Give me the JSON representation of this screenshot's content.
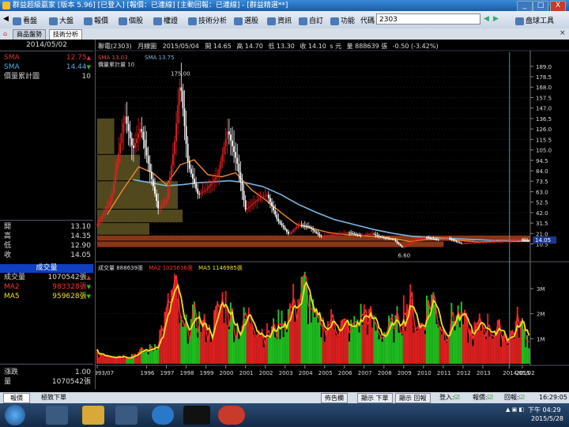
{
  "window": {
    "title": "群益超級贏家 [版本 5.96] [已登入] [報價：已連線] [主動回報：已連線] - [群益精選**]",
    "min": "_",
    "max": "□",
    "close": "X"
  },
  "menu": {
    "items": [
      "看盤",
      "大盤",
      "報價",
      "個股",
      "權證",
      "技術分析",
      "選股",
      "資訊",
      "自訂",
      "功能"
    ],
    "code_label": "代碼",
    "code_value": "2303",
    "right_item": "盘球工具"
  },
  "tabs": [
    "商品盤勢",
    "技術分析"
  ],
  "left_panel": {
    "date": "2014/05/02",
    "indicators": [
      {
        "label": "SMA",
        "value": "12.75",
        "arrow": "▲"
      },
      {
        "label": "SMA",
        "value": "14.44",
        "arrow": "▼"
      },
      {
        "label": "價量累計圖",
        "value": "10",
        "arrow": ""
      }
    ],
    "ohlc": [
      {
        "label": "開",
        "value": "13.10"
      },
      {
        "label": "高",
        "value": "14.35"
      },
      {
        "label": "低",
        "value": "12.90"
      },
      {
        "label": "收",
        "value": "14.05"
      }
    ],
    "volume_header": "成交量",
    "volume_rows": [
      {
        "label": "成交量",
        "value": "1070542張",
        "arrow": "▲"
      },
      {
        "label": "MA2",
        "value": "983328張",
        "arrow": "▼"
      },
      {
        "label": "MA5",
        "value": "959628張",
        "arrow": "▼"
      }
    ],
    "bottom_rows": [
      {
        "label": "漲跌",
        "value": "1.00"
      },
      {
        "label": "量",
        "value": "1070542張"
      }
    ]
  },
  "price_header": {
    "name": "聯電(2303)",
    "period": "月線圖",
    "date": "2015/05/04",
    "open": "開 14.65",
    "high": "高 14.70",
    "low": "低 13.30",
    "close": "收 14.10",
    "unit": "s 元",
    "volume": "量 888639 張",
    "change": "-0.50 (-3.42%)"
  },
  "price_legend": {
    "sma1": "SMA 13.03",
    "sma2": "SMA 13.75",
    "vp": "價量累計量 10"
  },
  "annotations": {
    "high": "175.00",
    "low": "6.60"
  },
  "volume_header": {
    "vol": "成交量 888639",
    "ma2": "MA2 1025616",
    "ma5": "MA5 1146985",
    "unit": "張"
  },
  "colors": {
    "up": "#e02020",
    "down": "#ffffff",
    "sma_short": "#f08a30",
    "sma_long": "#7ab8e0",
    "vol_up": "#e02020",
    "vol_down": "#20c020",
    "ma2": "#ff3030",
    "ma5": "#f0e020",
    "panel_bg": "#000000",
    "vp_bar": "#5a5020",
    "vp_band": "#a0401a"
  },
  "chart_data": [
    {
      "type": "candlestick",
      "title": "聯電(2303) 月線圖",
      "y_ticks": [
        "189.0",
        "178.5",
        "168.0",
        "157.5",
        "147.0",
        "136.5",
        "126.0",
        "115.5",
        "105.0",
        "94.5",
        "84.0",
        "73.5",
        "63.0",
        "52.5",
        "42.0",
        "31.5",
        "21.0",
        "10.5"
      ],
      "y_range": [
        3,
        192
      ],
      "current_price_label": "14.05",
      "x_ticks": [
        "1993/07",
        "1996",
        "1997",
        "1998",
        "1999",
        "2000",
        "2001",
        "2002",
        "2003",
        "2004",
        "2005",
        "2006",
        "2007",
        "2008",
        "2009",
        "2010",
        "2011",
        "2012",
        "2013",
        "2014/05/02",
        "2015"
      ],
      "x_range": [
        1993.5,
        2015.4
      ],
      "key_points": [
        {
          "t": 1993.5,
          "p": 30
        },
        {
          "t": 1994.2,
          "p": 55
        },
        {
          "t": 1994.9,
          "p": 140
        },
        {
          "t": 1995.3,
          "p": 105
        },
        {
          "t": 1995.7,
          "p": 128
        },
        {
          "t": 1996.2,
          "p": 80
        },
        {
          "t": 1996.6,
          "p": 45
        },
        {
          "t": 1997.0,
          "p": 55
        },
        {
          "t": 1997.4,
          "p": 110
        },
        {
          "t": 1997.7,
          "p": 175
        },
        {
          "t": 1998.1,
          "p": 90
        },
        {
          "t": 1998.6,
          "p": 60
        },
        {
          "t": 1999.0,
          "p": 65
        },
        {
          "t": 1999.6,
          "p": 80
        },
        {
          "t": 2000.1,
          "p": 125
        },
        {
          "t": 2000.6,
          "p": 90
        },
        {
          "t": 2001.0,
          "p": 45
        },
        {
          "t": 2001.6,
          "p": 55
        },
        {
          "t": 2002.1,
          "p": 60
        },
        {
          "t": 2002.6,
          "p": 35
        },
        {
          "t": 2003.2,
          "p": 20
        },
        {
          "t": 2003.7,
          "p": 30
        },
        {
          "t": 2004.2,
          "p": 28
        },
        {
          "t": 2004.8,
          "p": 18
        },
        {
          "t": 2005.5,
          "p": 20
        },
        {
          "t": 2006.2,
          "p": 22
        },
        {
          "t": 2006.8,
          "p": 19
        },
        {
          "t": 2007.4,
          "p": 21
        },
        {
          "t": 2007.9,
          "p": 17
        },
        {
          "t": 2008.5,
          "p": 15
        },
        {
          "t": 2008.95,
          "p": 6.6
        },
        {
          "t": 2009.6,
          "p": 15
        },
        {
          "t": 2010.1,
          "p": 17
        },
        {
          "t": 2010.7,
          "p": 15
        },
        {
          "t": 2011.3,
          "p": 16
        },
        {
          "t": 2011.9,
          "p": 11
        },
        {
          "t": 2012.5,
          "p": 12
        },
        {
          "t": 2013.1,
          "p": 12.5
        },
        {
          "t": 2013.8,
          "p": 13
        },
        {
          "t": 2014.3,
          "p": 13.5
        },
        {
          "t": 2014.9,
          "p": 15
        },
        {
          "t": 2015.35,
          "p": 14.1
        }
      ],
      "sma_short": [
        {
          "t": 1994.0,
          "p": 40
        },
        {
          "t": 1994.8,
          "p": 65
        },
        {
          "t": 1995.6,
          "p": 88
        },
        {
          "t": 1996.3,
          "p": 82
        },
        {
          "t": 1997.0,
          "p": 70
        },
        {
          "t": 1997.7,
          "p": 90
        },
        {
          "t": 1998.4,
          "p": 95
        },
        {
          "t": 1999.1,
          "p": 80
        },
        {
          "t": 1999.8,
          "p": 78
        },
        {
          "t": 2000.5,
          "p": 82
        },
        {
          "t": 2001.3,
          "p": 65
        },
        {
          "t": 2002.0,
          "p": 55
        },
        {
          "t": 2002.8,
          "p": 42
        },
        {
          "t": 2003.6,
          "p": 30
        },
        {
          "t": 2004.4,
          "p": 26
        },
        {
          "t": 2005.2,
          "p": 22
        },
        {
          "t": 2006.0,
          "p": 20
        },
        {
          "t": 2006.8,
          "p": 19
        },
        {
          "t": 2007.6,
          "p": 18
        },
        {
          "t": 2008.5,
          "p": 16
        },
        {
          "t": 2009.3,
          "p": 13
        },
        {
          "t": 2010.2,
          "p": 15
        },
        {
          "t": 2011.0,
          "p": 15.5
        },
        {
          "t": 2011.8,
          "p": 14
        },
        {
          "t": 2012.8,
          "p": 12.5
        },
        {
          "t": 2013.8,
          "p": 13
        },
        {
          "t": 2015.35,
          "p": 13.03
        }
      ],
      "sma_long": [
        {
          "t": 1995.3,
          "p": 75
        },
        {
          "t": 1996.2,
          "p": 72
        },
        {
          "t": 1997.0,
          "p": 69
        },
        {
          "t": 1997.8,
          "p": 70
        },
        {
          "t": 1998.6,
          "p": 72
        },
        {
          "t": 1999.4,
          "p": 73
        },
        {
          "t": 2000.2,
          "p": 74
        },
        {
          "t": 2001.0,
          "p": 72
        },
        {
          "t": 2001.9,
          "p": 68
        },
        {
          "t": 2002.8,
          "p": 60
        },
        {
          "t": 2003.7,
          "p": 50
        },
        {
          "t": 2004.6,
          "p": 42
        },
        {
          "t": 2005.5,
          "p": 35
        },
        {
          "t": 2006.5,
          "p": 30
        },
        {
          "t": 2007.5,
          "p": 25
        },
        {
          "t": 2008.5,
          "p": 21
        },
        {
          "t": 2009.5,
          "p": 18
        },
        {
          "t": 2010.5,
          "p": 17
        },
        {
          "t": 2011.5,
          "p": 16
        },
        {
          "t": 2012.5,
          "p": 15
        },
        {
          "t": 2013.5,
          "p": 14
        },
        {
          "t": 2015.35,
          "p": 13.75
        }
      ],
      "volume_profile": [
        {
          "lo": 100,
          "hi": 136.5,
          "weight": 0.18
        },
        {
          "lo": 73.5,
          "hi": 100,
          "weight": 0.45
        },
        {
          "lo": 45,
          "hi": 73.5,
          "weight": 0.85
        },
        {
          "lo": 31.5,
          "hi": 45,
          "weight": 0.9
        },
        {
          "lo": 19,
          "hi": 31.5,
          "weight": 0.55
        },
        {
          "lo": 13,
          "hi": 19,
          "weight": 1.0
        },
        {
          "lo": 6.6,
          "hi": 13,
          "weight": 0.8
        }
      ]
    },
    {
      "type": "bar",
      "title": "成交量",
      "y_ticks": [
        "3M",
        "2M",
        "1M"
      ],
      "y_range": [
        0,
        3600000
      ],
      "x_range": [
        1993.5,
        2015.4
      ],
      "volume_key_points": [
        {
          "t": 1993.5,
          "v": 400000
        },
        {
          "t": 1995.0,
          "v": 300000
        },
        {
          "t": 1996.3,
          "v": 600000
        },
        {
          "t": 1996.9,
          "v": 1600000
        },
        {
          "t": 1997.4,
          "v": 3000000
        },
        {
          "t": 1997.8,
          "v": 1200000
        },
        {
          "t": 1998.5,
          "v": 1800000
        },
        {
          "t": 1999.2,
          "v": 1200000
        },
        {
          "t": 1999.9,
          "v": 2600000
        },
        {
          "t": 2000.5,
          "v": 1400000
        },
        {
          "t": 2001.3,
          "v": 1900000
        },
        {
          "t": 2002.0,
          "v": 1100000
        },
        {
          "t": 2002.8,
          "v": 1600000
        },
        {
          "t": 2003.3,
          "v": 2200000
        },
        {
          "t": 2004.0,
          "v": 2900000
        },
        {
          "t": 2004.6,
          "v": 1400000
        },
        {
          "t": 2005.5,
          "v": 1700000
        },
        {
          "t": 2006.3,
          "v": 1300000
        },
        {
          "t": 2007.0,
          "v": 2000000
        },
        {
          "t": 2007.8,
          "v": 1200000
        },
        {
          "t": 2008.6,
          "v": 1500000
        },
        {
          "t": 2009.2,
          "v": 2500000
        },
        {
          "t": 2009.8,
          "v": 1400000
        },
        {
          "t": 2010.4,
          "v": 2700000
        },
        {
          "t": 2011.0,
          "v": 1300000
        },
        {
          "t": 2011.7,
          "v": 2000000
        },
        {
          "t": 2012.4,
          "v": 1100000
        },
        {
          "t": 2013.0,
          "v": 1600000
        },
        {
          "t": 2013.7,
          "v": 1300000
        },
        {
          "t": 2014.35,
          "v": 1070542
        },
        {
          "t": 2014.8,
          "v": 1700000
        },
        {
          "t": 2015.35,
          "v": 888639
        }
      ]
    }
  ],
  "statusbar": {
    "left1": "報價",
    "left2": "極致下單",
    "mid": "佈告欄",
    "b1": "顯示 下單",
    "b2": "顯示 回報",
    "login": "登入:",
    "quote": "報價:",
    "report": "回報:",
    "time": "16:29:05"
  },
  "taskbar": {
    "time": "下午 04:29",
    "date": "2015/5/28"
  }
}
